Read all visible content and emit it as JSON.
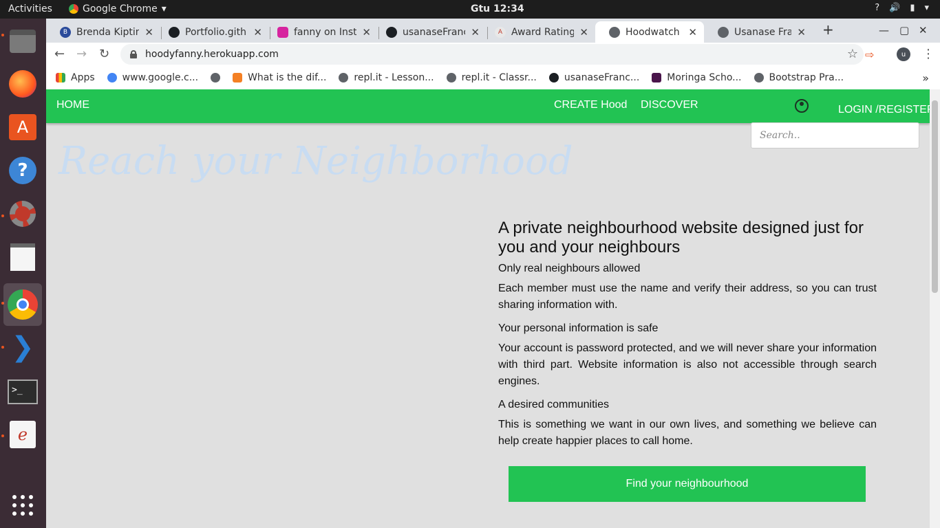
{
  "topbar": {
    "activities": "Activities",
    "app_name": "Google Chrome",
    "clock": "Gtu 12:34"
  },
  "tabs": [
    {
      "label": "Brenda Kiptim",
      "color": "#2b4b9b",
      "letter": "B"
    },
    {
      "label": "Portfolio.gith",
      "color": "#1b1f23",
      "letter": ""
    },
    {
      "label": "fanny on Insta",
      "color": "#d6249f",
      "letter": ""
    },
    {
      "label": "usanaseFranc",
      "color": "#1b1f23",
      "letter": ""
    },
    {
      "label": "Award Rating",
      "color": "#e8e8e8",
      "letter": ""
    },
    {
      "label": "Hoodwatch",
      "color": "#5f6368",
      "letter": ""
    },
    {
      "label": "Usanase Fran",
      "color": "#5f6368",
      "letter": ""
    }
  ],
  "url": "hoodyfanny.herokuapp.com",
  "bookmarks": [
    {
      "label": "Apps",
      "color": "#e94235"
    },
    {
      "label": "www.google.c...",
      "color": "#4285f4"
    },
    {
      "label": "",
      "color": "#5f6368"
    },
    {
      "label": "What is the dif...",
      "color": "#f48024"
    },
    {
      "label": "repl.it - Lesson...",
      "color": "#5f6368"
    },
    {
      "label": "repl.it - Classr...",
      "color": "#5f6368"
    },
    {
      "label": "usanaseFranc...",
      "color": "#1b1f23"
    },
    {
      "label": "Moringa Scho...",
      "color": "#4a154b"
    },
    {
      "label": "Bootstrap Pra...",
      "color": "#5f6368"
    }
  ],
  "site": {
    "nav_home": "HOME",
    "nav_create": "CREATE Hood",
    "nav_discover": "DISCOVER",
    "nav_login": "LOGIN /REGISTER",
    "search_placeholder": "Search..",
    "hero": "Reach your Neighborhood",
    "headline": "A private neighbourhood website designed just for you and your neighbours",
    "sections": [
      {
        "title": "Only real neighbours allowed",
        "body": "Each member must use the name and verify their address, so you can trust sharing information with."
      },
      {
        "title": "Your personal information is safe",
        "body": "Your account is password protected, and we will never share your information with third part. Website information is also not accessible through search engines."
      },
      {
        "title": "A desired communities",
        "body": "This is something we want in our own lives, and something we believe can help create happier places to call home."
      }
    ],
    "cta": "Find your neighbourhood",
    "brand_color": "#22c353"
  }
}
